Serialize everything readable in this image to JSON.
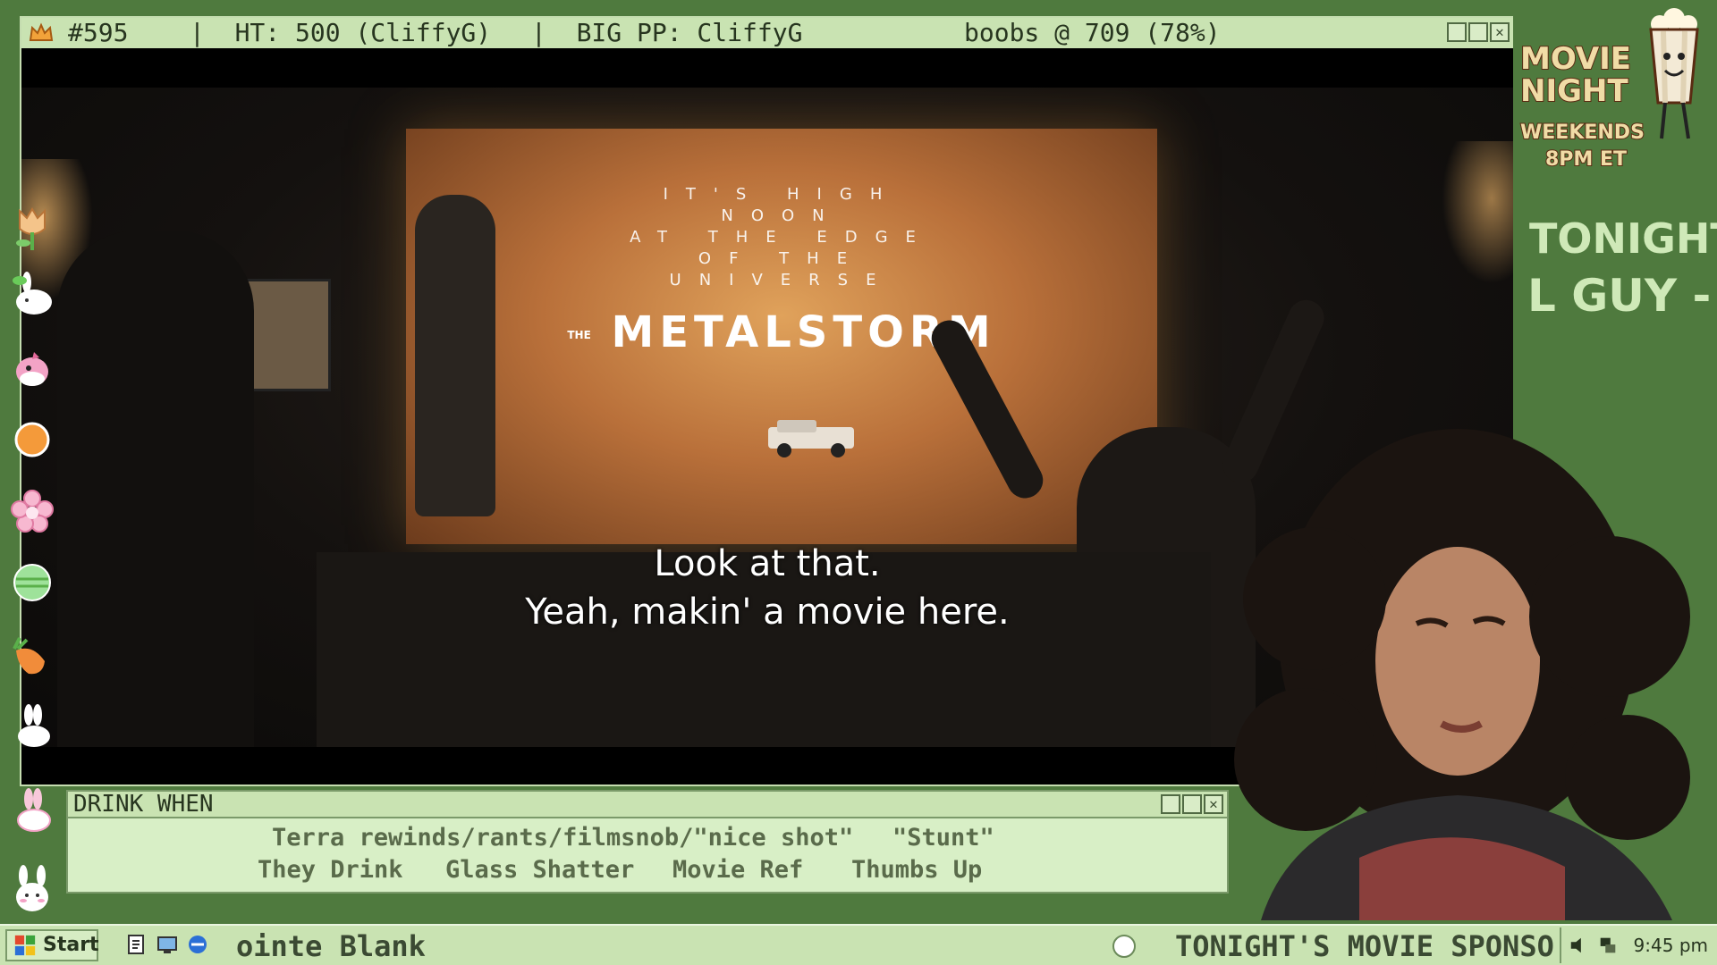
{
  "main_window": {
    "title_number": "#595",
    "ht": "|  HT: 500 (CliffyG)",
    "big_pp": "|  BIG PP: CliffyG",
    "status": "boobs @ 709 (78%)"
  },
  "video": {
    "tagline_lines": [
      "IT'S HIGH",
      "NOON",
      "AT THE EDGE",
      "OF THE",
      "UNIVERSE"
    ],
    "movie_title_prefix": "THE",
    "movie_title": "METALSTORM",
    "subtitle_lines": [
      "Look at that.",
      "Yeah, makin' a movie here."
    ]
  },
  "drink_window": {
    "title": "DRINK WHEN",
    "rules": [
      "Terra rewinds/rants/filmsnob/\"nice shot\"",
      "\"Stunt\"",
      "They Drink",
      "Glass Shatter",
      "Movie Ref",
      "Thumbs Up"
    ]
  },
  "side_panel": {
    "poster_lines": [
      "MOVIE",
      "NIGHT",
      "WEEKENDS",
      "8PM ET"
    ],
    "tonight_label": "TONIGHT:",
    "tonight_movie_fragment": "L GUY -"
  },
  "taskbar": {
    "start_label": "Start",
    "marquee_left": "ointe Blank",
    "marquee_right": "TONIGHT'S MOVIE SPONSO",
    "clock": "9:45 pm"
  },
  "colors": {
    "frame_green": "#4f7a3e",
    "panel_light": "#c9e3b2",
    "window_bg": "#d8efc6",
    "text_dark": "#27351f"
  },
  "icons": [
    "crown-icon",
    "tulip-icon",
    "bunny-icon",
    "pink-bird-icon",
    "orange-ball-icon",
    "flower-icon",
    "green-egg-icon",
    "carrot-icon",
    "white-bunny-icon",
    "pink-bunny-icon",
    "bunny-face-icon"
  ]
}
